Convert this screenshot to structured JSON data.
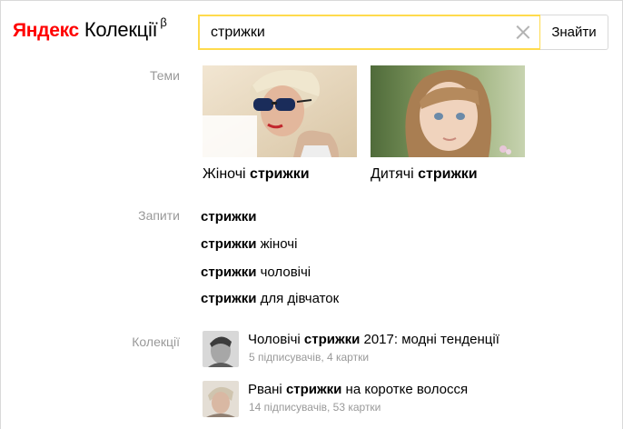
{
  "header": {
    "logo_brand": "Яндекс",
    "logo_product": "Колекції",
    "logo_beta": "β",
    "search_value": "стрижки",
    "search_button": "Знайти"
  },
  "themes": {
    "label": "Теми",
    "items": [
      {
        "prefix": "Жіночі ",
        "query": "стрижки"
      },
      {
        "prefix": "Дитячі ",
        "query": "стрижки"
      }
    ]
  },
  "queries": {
    "label": "Запити",
    "items": [
      {
        "bold": "стрижки",
        "rest": ""
      },
      {
        "bold": "стрижки",
        "rest": " жіночі"
      },
      {
        "bold": "стрижки",
        "rest": " чоловічі"
      },
      {
        "bold": "стрижки",
        "rest": " для дівчаток"
      }
    ]
  },
  "collections": {
    "label": "Колекції",
    "items": [
      {
        "title_before": "Чоловічі ",
        "title_bold": "стрижки",
        "title_after": " 2017: модні тенденції",
        "meta": "5 підписувачів, 4 картки"
      },
      {
        "title_before": "Рвані ",
        "title_bold": "стрижки",
        "title_after": " на коротке волосся",
        "meta": "14 підписувачів, 53 картки"
      }
    ]
  },
  "colors": {
    "brand_red": "#ff0000",
    "search_border": "#ffdb4d",
    "muted_label": "#999999"
  }
}
